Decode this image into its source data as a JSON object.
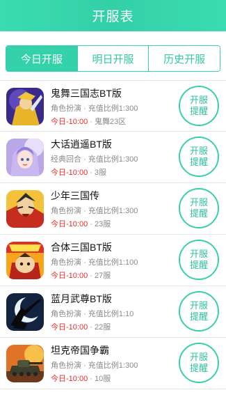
{
  "header": {
    "title": "开服表"
  },
  "tabs": [
    {
      "label": "今日开服",
      "active": true
    },
    {
      "label": "明日开服",
      "active": false
    },
    {
      "label": "历史开服",
      "active": false
    }
  ],
  "games": [
    {
      "name": "鬼舞三国志BT版",
      "genre": "角色扮演",
      "ratio": "充值比例1:300",
      "time": "今日-10:00",
      "server": "鬼舞23区",
      "icon": "warrior-gold-icon",
      "button": [
        "开服",
        "提醒"
      ]
    },
    {
      "name": "大话逍遥BT版",
      "genre": "经典回合",
      "ratio": "充值比例1:300",
      "time": "今日-10:00",
      "server": "3服",
      "icon": "fairy-girl-icon",
      "button": [
        "开服",
        "提醒"
      ]
    },
    {
      "name": "少年三国传",
      "genre": "角色扮演",
      "ratio": "充值比例1:300",
      "time": "今日-10:00",
      "server": "23服",
      "icon": "red-warrior-icon",
      "button": [
        "开服",
        "提醒"
      ]
    },
    {
      "name": "合体三国BT版",
      "genre": "角色扮演",
      "ratio": "充值比例1:100",
      "time": "今日-10:00",
      "server": "27服",
      "icon": "chibi-hero-icon",
      "button": [
        "开服",
        "提醒"
      ]
    },
    {
      "name": "蓝月武尊BT版",
      "genre": "角色扮演",
      "ratio": "充值比例1:10",
      "time": "今日-10:00",
      "server": "22服",
      "icon": "moon-swordsman-icon",
      "button": [
        "开服",
        "提醒"
      ]
    },
    {
      "name": "坦克帝国争霸",
      "genre": "角色扮演",
      "ratio": "充值比例1:300",
      "time": "今日-10:00",
      "server": "10服",
      "icon": "tank-icon",
      "button": [
        "开服",
        "提醒"
      ]
    }
  ],
  "separator": "·",
  "colors": {
    "accent": "#35d1ab",
    "highlight": "#e0312b",
    "muted": "#8a8a8a"
  }
}
